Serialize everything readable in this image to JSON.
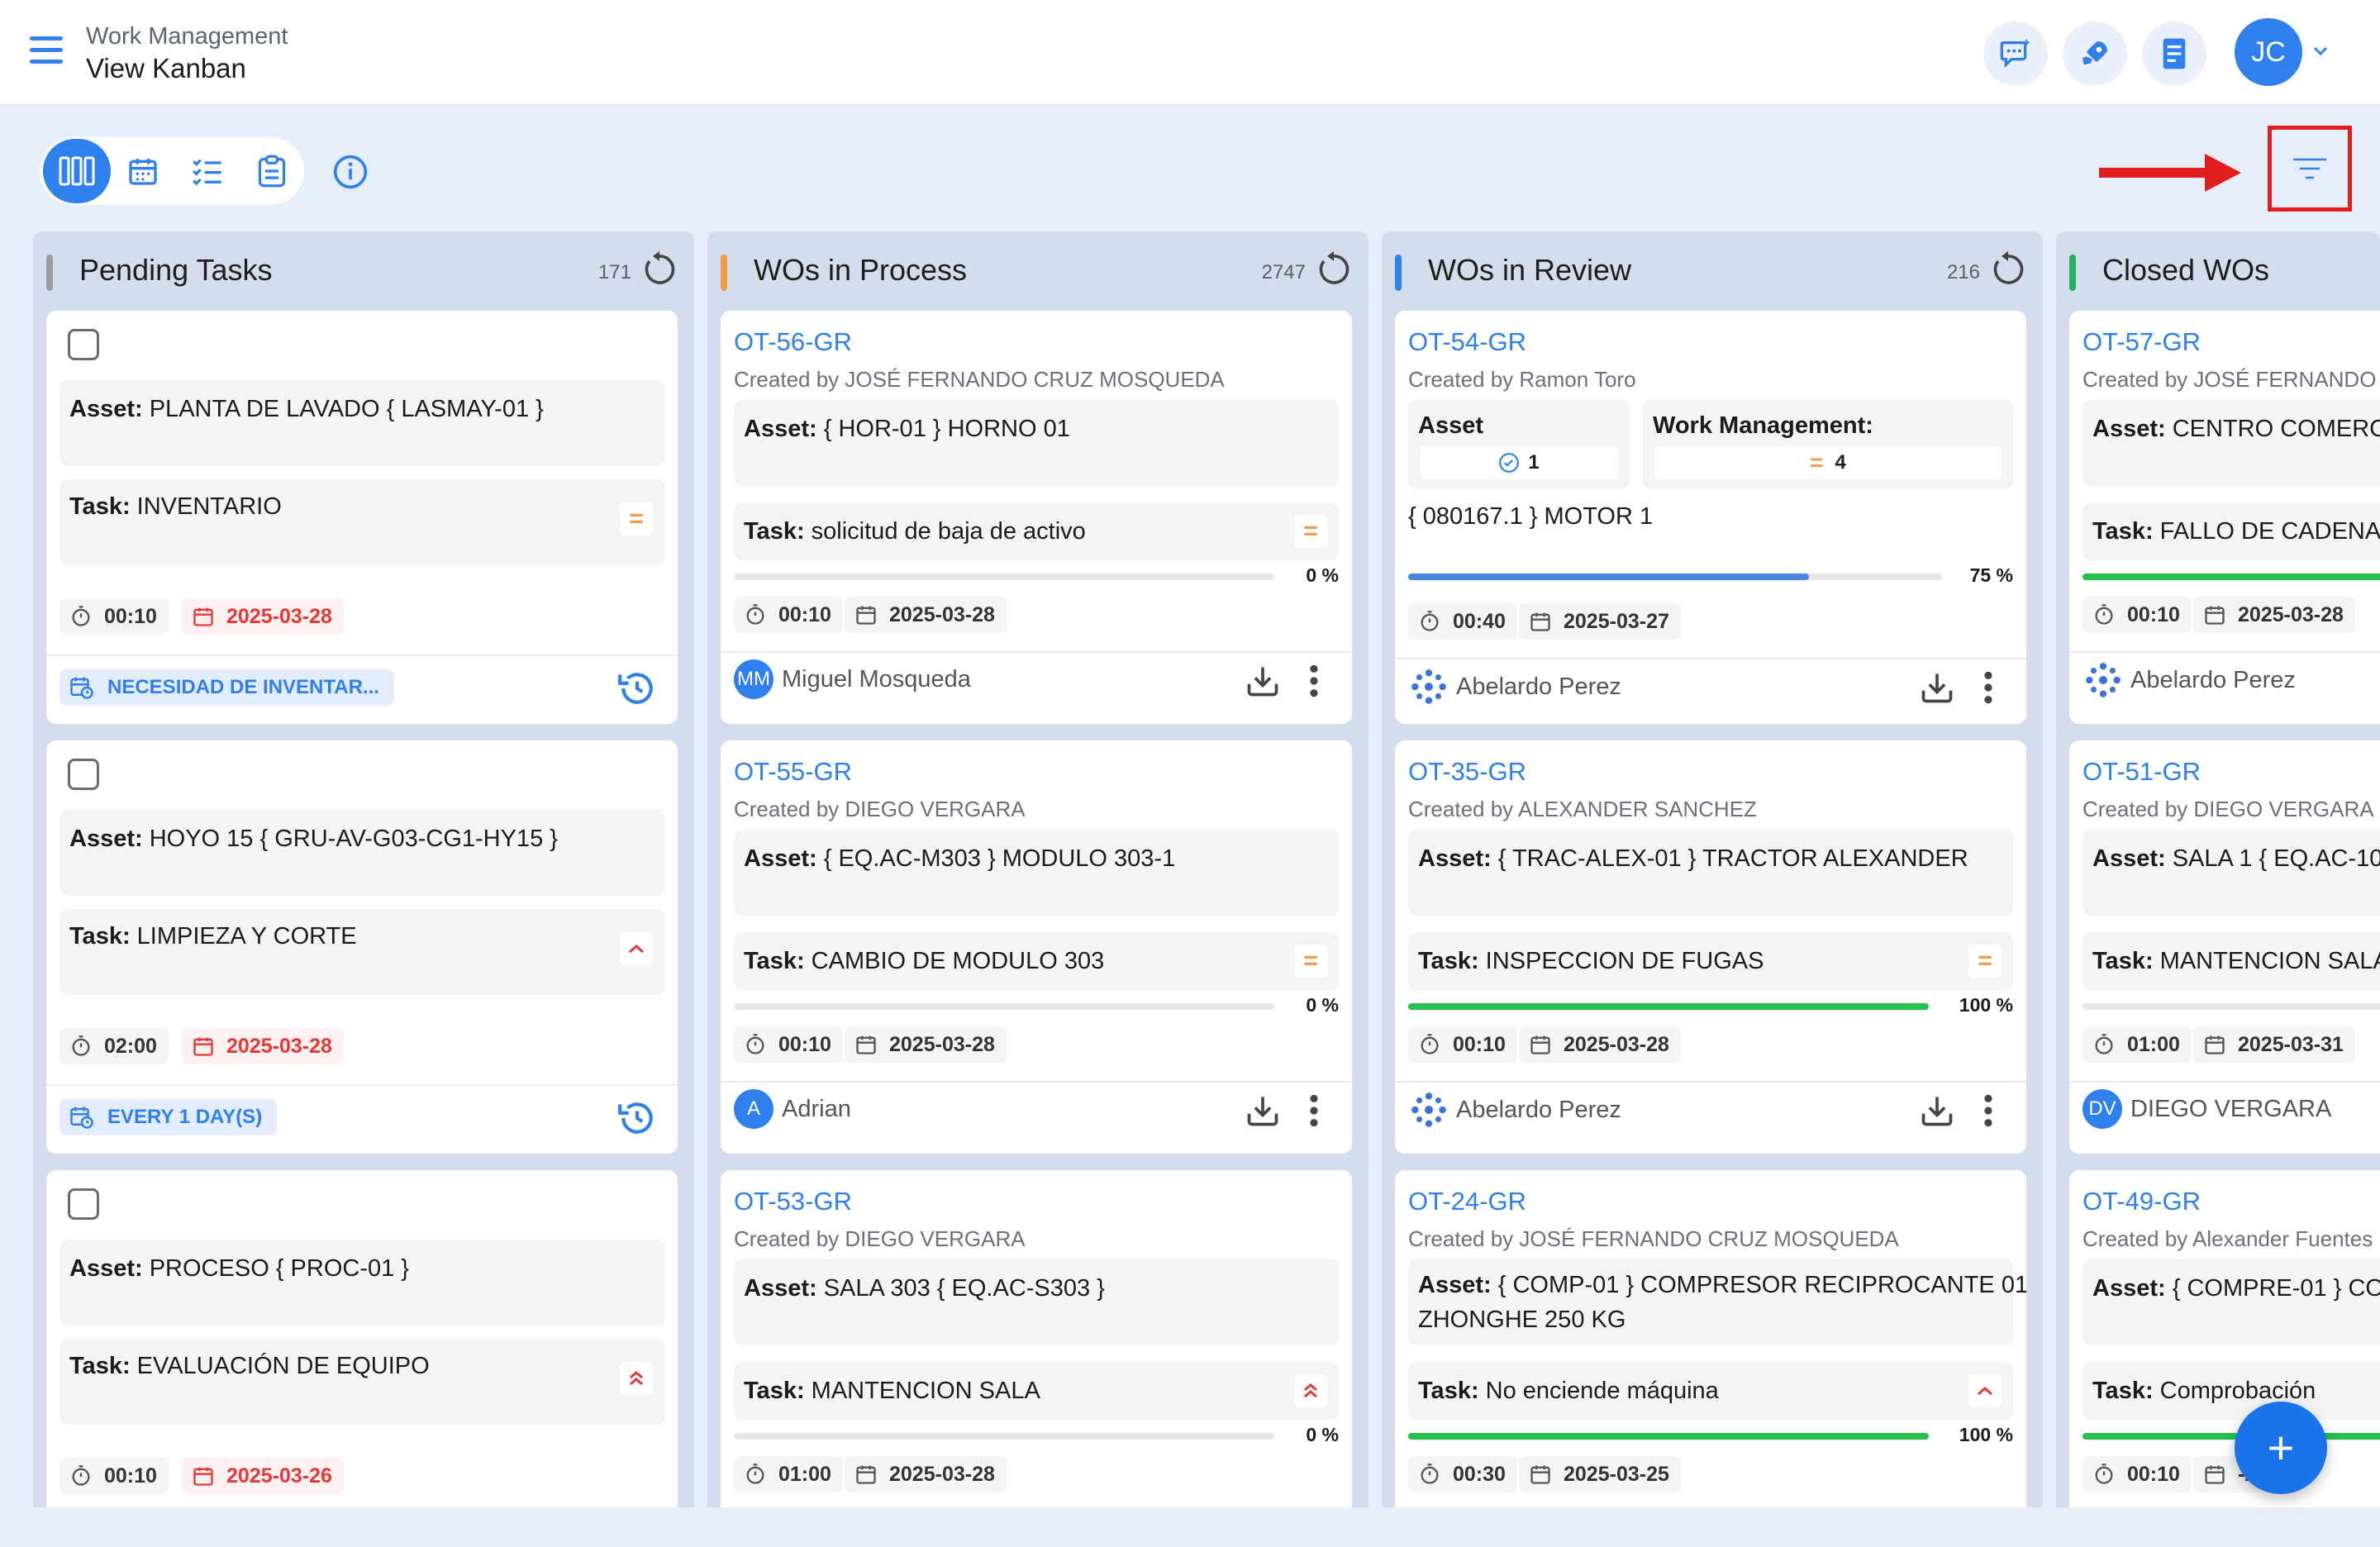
{
  "header": {
    "section": "Work Management",
    "title": "View Kanban",
    "avatar_initials": "JC"
  },
  "colors": {
    "accent": "#2f80ed",
    "pending": "#9e9e9e",
    "process": "#f2994a",
    "review": "#2f80ed",
    "closed": "#27ae60",
    "danger": "#e53935",
    "highlight": "#e11d1d"
  },
  "toolbar": {
    "icons": [
      "kanban-view-icon",
      "calendar-view-icon",
      "checklist-view-icon",
      "clipboard-view-icon",
      "info-icon",
      "filter-icon"
    ]
  },
  "columns": {
    "pending": {
      "title": "Pending Tasks",
      "count": "171",
      "cards": [
        {
          "asset_label": "Asset:",
          "asset": "PLANTA DE LAVADO { LASMAY-01 }",
          "task_label": "Task:",
          "task": "INVENTARIO",
          "time": "00:10",
          "date": "2025-03-28",
          "tag": "NECESIDAD DE INVENTAR..."
        },
        {
          "asset_label": "Asset:",
          "asset": "HOYO 15 { GRU-AV-G03-CG1-HY15 }",
          "task_label": "Task:",
          "task": "LIMPIEZA Y CORTE",
          "time": "02:00",
          "date": "2025-03-28",
          "tag": "EVERY 1 DAY(S)"
        },
        {
          "asset_label": "Asset:",
          "asset": "PROCESO { PROC-01 }",
          "task_label": "Task:",
          "task": "EVALUACIÓN DE EQUIPO",
          "time": "00:10",
          "date": "2025-03-26"
        }
      ]
    },
    "process": {
      "title": "WOs in Process",
      "count": "2747",
      "cards": [
        {
          "code": "OT-56-GR",
          "creator": "Created by JOSÉ FERNANDO CRUZ MOSQUEDA",
          "asset_label": "Asset:",
          "asset": "{ HOR-01 } HORNO 01",
          "task_label": "Task:",
          "task": "solicitud de baja de activo",
          "progress": 0,
          "pct": "0 %",
          "time": "00:10",
          "date": "2025-03-28",
          "user": "Miguel Mosqueda",
          "initials": "MM"
        },
        {
          "code": "OT-55-GR",
          "creator": "Created by DIEGO VERGARA",
          "asset_label": "Asset:",
          "asset": "{ EQ.AC-M303 } MODULO 303-1",
          "task_label": "Task:",
          "task": "CAMBIO DE MODULO 303",
          "progress": 0,
          "pct": "0 %",
          "time": "00:10",
          "date": "2025-03-28",
          "user": "Adrian",
          "initials": "A"
        },
        {
          "code": "OT-53-GR",
          "creator": "Created by DIEGO VERGARA",
          "asset_label": "Asset:",
          "asset": "SALA 303 { EQ.AC-S303 }",
          "task_label": "Task:",
          "task": "MANTENCION SALA",
          "progress": 0,
          "pct": "0 %",
          "time": "01:00",
          "date": "2025-03-28"
        }
      ]
    },
    "review": {
      "title": "WOs in Review",
      "count": "216",
      "cards": [
        {
          "code": "OT-54-GR",
          "creator": "Created by Ramon Toro",
          "asset_header": "Asset",
          "asset_count": "1",
          "wm_header": "Work Management:",
          "wm_count": "4",
          "asset": "{ 080167.1 } MOTOR 1",
          "progress": 0.75,
          "pct": "75 %",
          "time": "00:40",
          "date": "2025-03-27",
          "user": "Abelardo Perez"
        },
        {
          "code": "OT-35-GR",
          "creator": "Created by ALEXANDER SANCHEZ",
          "asset_label": "Asset:",
          "asset": "{ TRAC-ALEX-01 } TRACTOR ALEXANDER",
          "task_label": "Task:",
          "task": "INSPECCION DE FUGAS",
          "progress": 1,
          "pct": "100 %",
          "time": "00:10",
          "date": "2025-03-28",
          "user": "Abelardo Perez"
        },
        {
          "code": "OT-24-GR",
          "creator": "Created by JOSÉ FERNANDO CRUZ MOSQUEDA",
          "asset_label": "Asset:",
          "asset_line1": "{ COMP-01 } COMPRESOR RECIPROCANTE 01",
          "asset_line2": "ZHONGHE 250 KG",
          "task_label": "Task:",
          "task": "No enciende máquina",
          "progress": 1,
          "pct": "100 %",
          "time": "00:30",
          "date": "2025-03-25"
        }
      ]
    },
    "closed": {
      "title": "Closed WOs",
      "cards": [
        {
          "code": "OT-57-GR",
          "creator": "Created by JOSÉ FERNANDO",
          "asset_label": "Asset:",
          "asset": "CENTRO COMERCI",
          "task_label": "Task:",
          "task": "FALLO DE CADENA",
          "time": "00:10",
          "date": "2025-03-28",
          "user": "Abelardo Perez"
        },
        {
          "code": "OT-51-GR",
          "creator": "Created by DIEGO VERGARA",
          "asset_label": "Asset:",
          "asset": "SALA 1 { EQ.AC-10",
          "task_label": "Task:",
          "task": "MANTENCION SALA",
          "time": "01:00",
          "date": "2025-03-31",
          "user": "DIEGO VERGARA",
          "initials": "DV"
        },
        {
          "code": "OT-49-GR",
          "creator": "Created by Alexander Fuentes",
          "asset_label": "Asset:",
          "asset": "{ COMPRE-01 } CO",
          "task_label": "Task:",
          "task": "Comprobación",
          "time": "00:10",
          "date": "-28"
        }
      ]
    }
  },
  "fab_label": "+"
}
